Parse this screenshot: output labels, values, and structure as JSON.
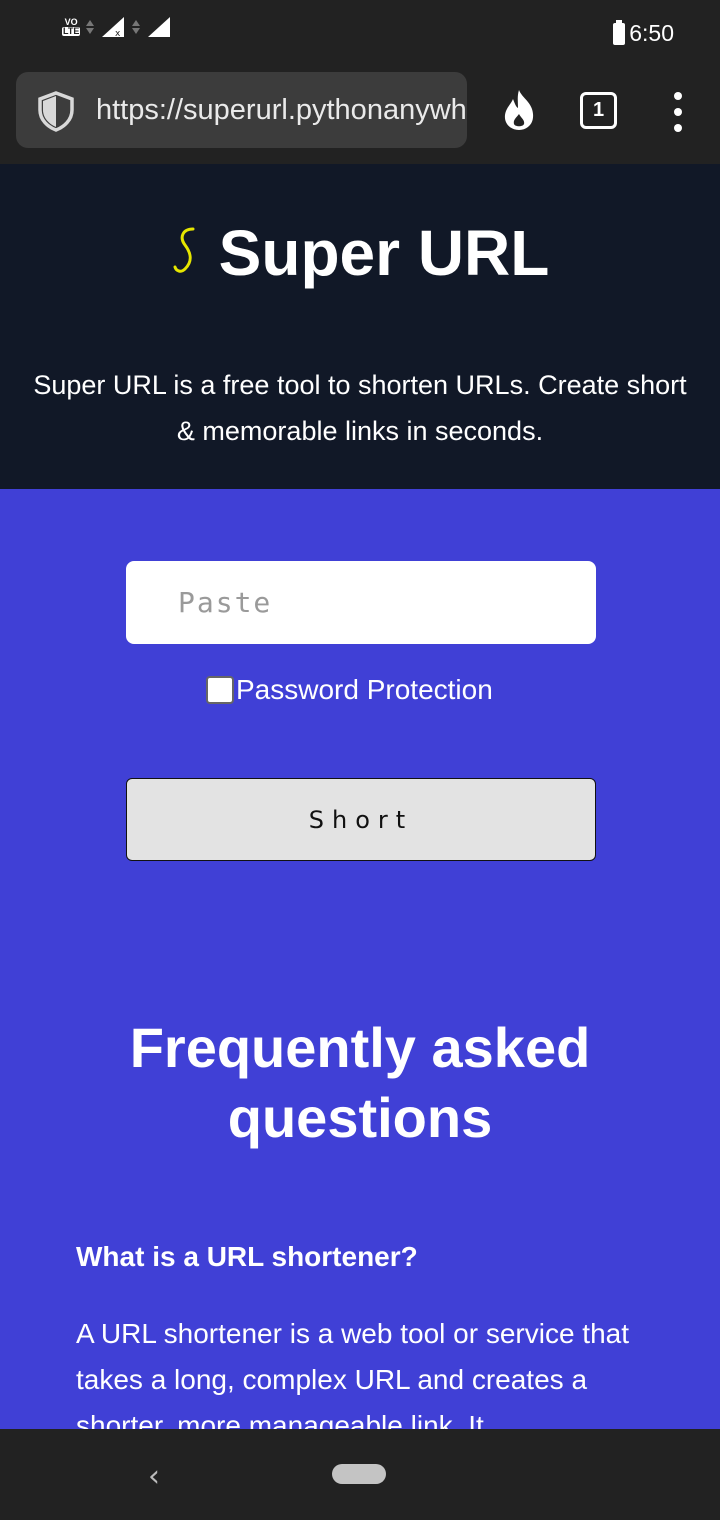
{
  "status_bar": {
    "network_badge_top": "VO",
    "network_badge_bottom": "LTE",
    "time": "6:50"
  },
  "browser": {
    "url": "https://superurl.pythonanywhere.com",
    "tab_count": "1",
    "icons": [
      "shield-icon",
      "fire-icon",
      "tabs-icon",
      "more-vert-icon"
    ]
  },
  "hero": {
    "logo_glyph": "S",
    "title": "Super URL",
    "tagline": "Super URL is a free tool to shorten URLs. Create short & memorable links in seconds."
  },
  "form": {
    "url_placeholder": "Paste",
    "url_value": "",
    "password_label": "Password Protection",
    "password_checked": false,
    "submit_label": "Short"
  },
  "faq": {
    "heading": "Frequently asked questions",
    "items": [
      {
        "question": "What is a URL shortener?",
        "answer": "A URL shortener is a web tool or service that takes a long, complex URL and creates a shorter, more manageable link. It"
      }
    ]
  },
  "colors": {
    "hero_bg": "#111827",
    "main_bg": "#4040d6",
    "logo": "#e6e600"
  }
}
